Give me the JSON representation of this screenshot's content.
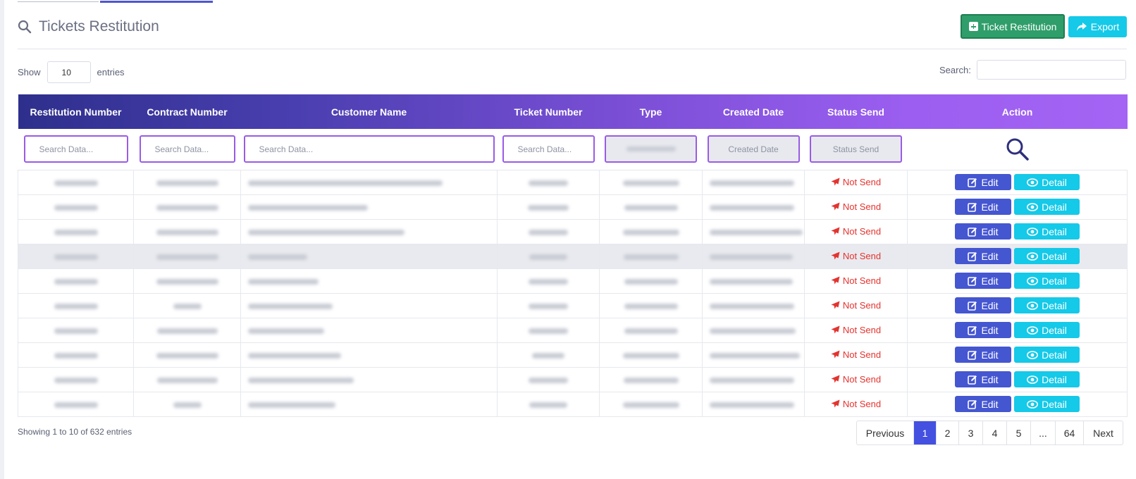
{
  "page": {
    "title": "Tickets Restitution"
  },
  "toolbar": {
    "add_label": "Ticket Restitution",
    "export_label": "Export"
  },
  "length_menu": {
    "show_label": "Show",
    "value": "10",
    "entries_label": "entries"
  },
  "search": {
    "label": "Search:",
    "value": ""
  },
  "table": {
    "columns": [
      "Restitution Number",
      "Contract Number",
      "Customer Name",
      "Ticket Number",
      "Type",
      "Created Date",
      "Status Send",
      "Action"
    ],
    "filters": {
      "restitution_number": "Search Data...",
      "contract_number": "Search Data...",
      "customer_name": "Search Data...",
      "ticket_number": "Search Data...",
      "created_date": "Created Date",
      "status_send": "Status Send"
    },
    "status_label": "Not Send",
    "edit_label": "Edit",
    "detail_label": "Detail",
    "row_count": 10
  },
  "info": "Showing 1 to 10 of 632 entries",
  "pagination": {
    "previous": "Previous",
    "pages": [
      "1",
      "2",
      "3",
      "4",
      "5",
      "...",
      "64"
    ],
    "active": "1",
    "next": "Next"
  },
  "colors": {
    "header_gradient_start": "#2e2f8c",
    "header_gradient_end": "#a464f4",
    "add_button": "#2f9e6a",
    "export_button": "#15c9e8",
    "edit_button": "#4556d1",
    "detail_button": "#15c9e8",
    "status_text": "#e3342f",
    "active_page": "#4350e0"
  },
  "icons": {
    "title": "search-icon",
    "add": "plus-square-icon",
    "export": "share-icon",
    "filter_search": "search-icon",
    "status": "paper-plane-icon",
    "edit": "edit-icon",
    "detail": "eye-icon"
  }
}
